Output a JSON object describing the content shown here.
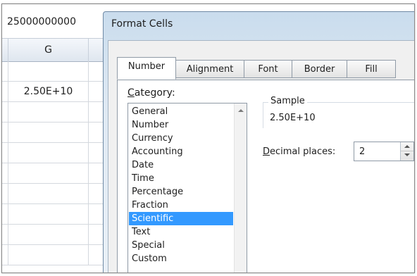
{
  "spreadsheet": {
    "formula_bar_value": "25000000000",
    "column_header": "G",
    "cells": [
      "",
      "2.50E+10",
      "",
      "",
      "",
      "",
      "",
      "",
      "",
      "",
      ""
    ]
  },
  "dialog": {
    "title": "Format Cells",
    "tabs": [
      {
        "label": "Number",
        "active": true
      },
      {
        "label": "Alignment",
        "active": false
      },
      {
        "label": "Font",
        "active": false
      },
      {
        "label": "Border",
        "active": false
      },
      {
        "label": "Fill",
        "active": false
      }
    ],
    "category": {
      "label_accel": "C",
      "label_rest": "ategory:",
      "items": [
        "General",
        "Number",
        "Currency",
        "Accounting",
        "Date",
        "Time",
        "Percentage",
        "Fraction",
        "Scientific",
        "Text",
        "Special",
        "Custom"
      ],
      "selected": "Scientific"
    },
    "sample": {
      "label": "Sample",
      "value": "2.50E+10"
    },
    "decimal_places": {
      "label_accel": "D",
      "label_rest": "ecimal places:",
      "value": "2"
    }
  },
  "colors": {
    "selection": "#3399ff",
    "dialog_title_bar": "#c9dced"
  }
}
